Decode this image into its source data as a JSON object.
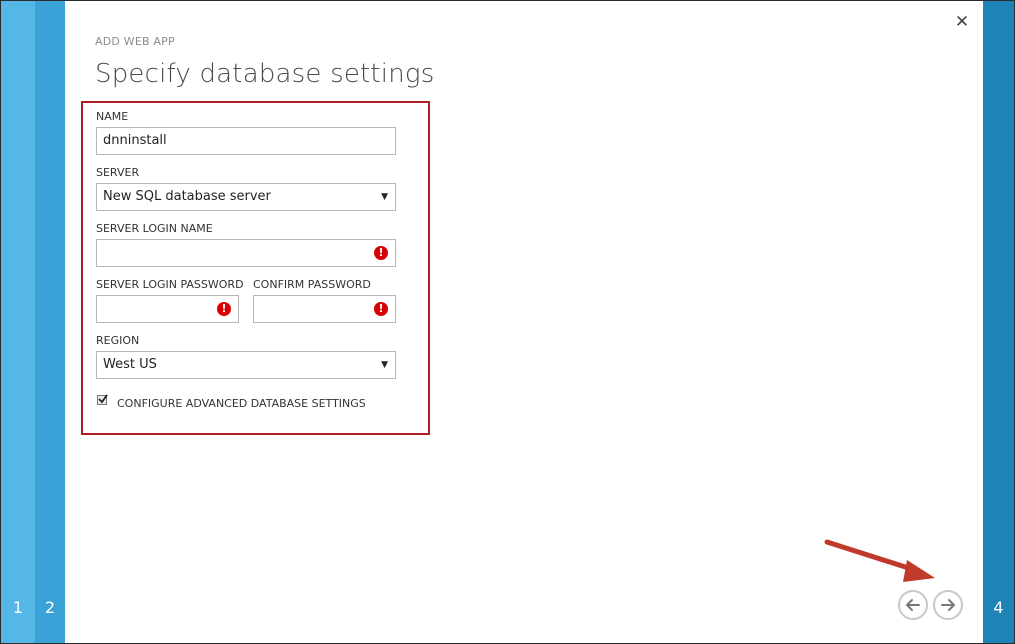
{
  "steps": {
    "step1": "1",
    "step2": "2",
    "step4": "4"
  },
  "dialog": {
    "kicker": "ADD WEB APP",
    "title": "Specify database settings",
    "close_glyph": "✕"
  },
  "form": {
    "name_label": "NAME",
    "name_value": "dnninstall",
    "server_label": "SERVER",
    "server_value": "New SQL database server",
    "login_label": "SERVER LOGIN NAME",
    "login_value": "",
    "password_label": "SERVER LOGIN PASSWORD",
    "confirm_label": "CONFIRM PASSWORD",
    "region_label": "REGION",
    "region_value": "West US",
    "advanced_label": "CONFIGURE ADVANCED DATABASE SETTINGS",
    "advanced_checked": true,
    "error_glyph": "!",
    "select_arrow": "▼"
  },
  "icons": {
    "back": "arrow-left-icon",
    "next": "arrow-right-icon",
    "annotation": "red-arrow-annotation-icon"
  },
  "colors": {
    "step1": "#55b7e6",
    "step2": "#3aa2d6",
    "step4": "#1e84b6",
    "highlight": "#b01d22",
    "error": "#d80000"
  }
}
